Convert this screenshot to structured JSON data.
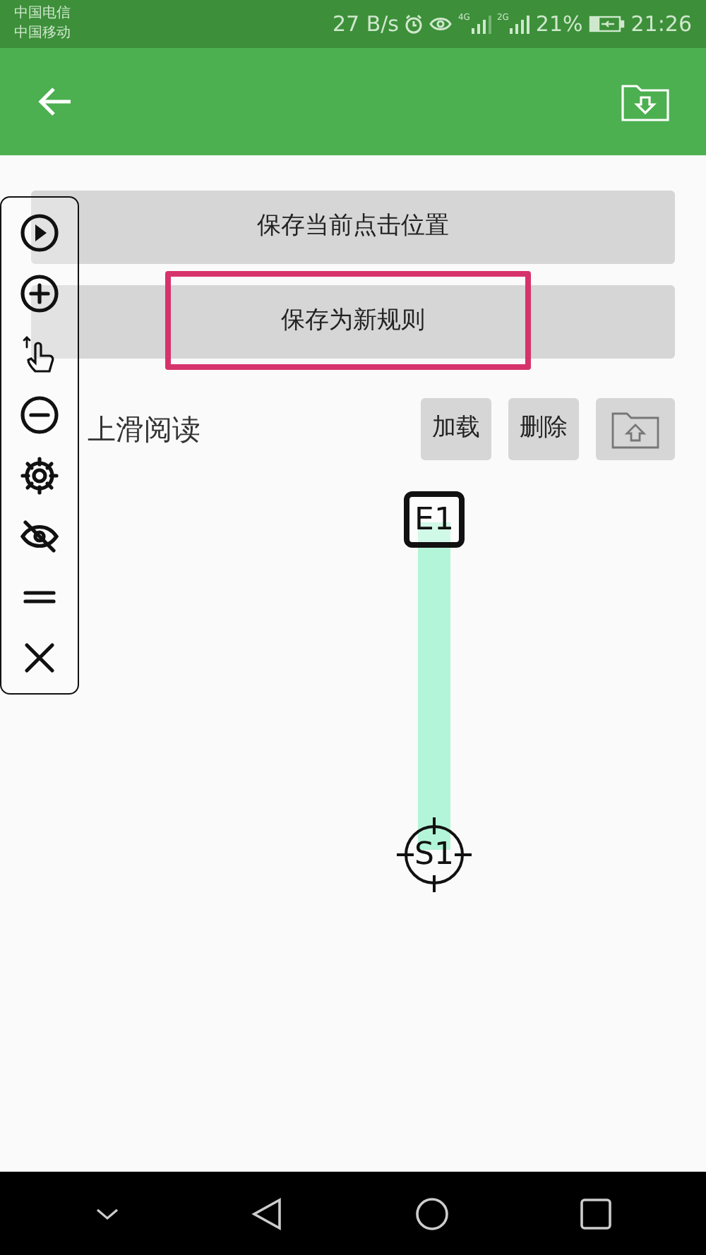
{
  "status_bar": {
    "carriers": [
      "中国电信",
      "中国移动"
    ],
    "speed": "27 B/s",
    "signals": [
      "4G",
      "2G"
    ],
    "battery": "21%",
    "time": "21:26"
  },
  "actions": [
    {
      "label": "保存当前点击位置",
      "highlighted": false
    },
    {
      "label": "保存为新规则",
      "highlighted": true
    }
  ],
  "rule": {
    "name": "上滑阅读",
    "buttons": [
      "加载",
      "删除"
    ]
  },
  "gesture": {
    "end_label": "E1",
    "start_label": "S1"
  }
}
